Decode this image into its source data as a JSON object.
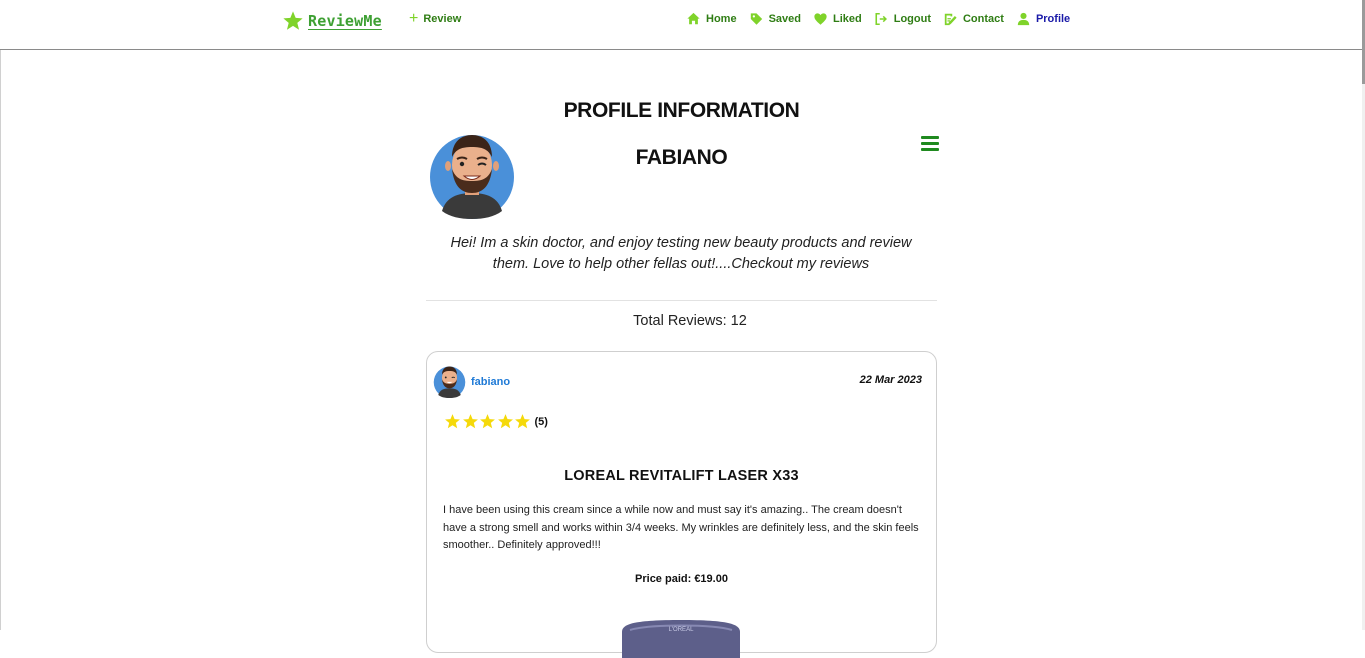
{
  "navbar": {
    "brand": "ReviewMe",
    "review_label": "Review",
    "items": [
      {
        "label": "Home",
        "icon": "home-icon"
      },
      {
        "label": "Saved",
        "icon": "tag-icon"
      },
      {
        "label": "Liked",
        "icon": "heart-icon"
      },
      {
        "label": "Logout",
        "icon": "logout-icon"
      },
      {
        "label": "Contact",
        "icon": "contact-edit-icon"
      },
      {
        "label": "Profile",
        "icon": "user-icon"
      }
    ]
  },
  "profile": {
    "heading": "PROFILE INFORMATION",
    "name": "FABIANO",
    "bio": "Hei! Im a skin doctor, and enjoy testing new beauty products and review them. Love to help other fellas out!....Checkout my reviews",
    "total_reviews": "Total Reviews: 12"
  },
  "review": {
    "username": "fabiano",
    "date": "22 Mar 2023",
    "stars": 5,
    "rating_label": "(5)",
    "product": "LOREAL REVITALIFT LASER X33",
    "text": "I have been using this cream since a while now and must say it's amazing.. The cream doesn't have a strong smell and works within 3/4 weeks. My wrinkles are definitely less, and the skin feels smoother.. Definitely approved!!!",
    "price": "Price paid: €19.00"
  },
  "colors": {
    "nav_green": "#2f7d14",
    "profile_link": "#1a1aa8",
    "star_yellow": "#f5d90a",
    "username_blue": "#1f7ad6",
    "avatar_bg": "#4a90d9"
  }
}
